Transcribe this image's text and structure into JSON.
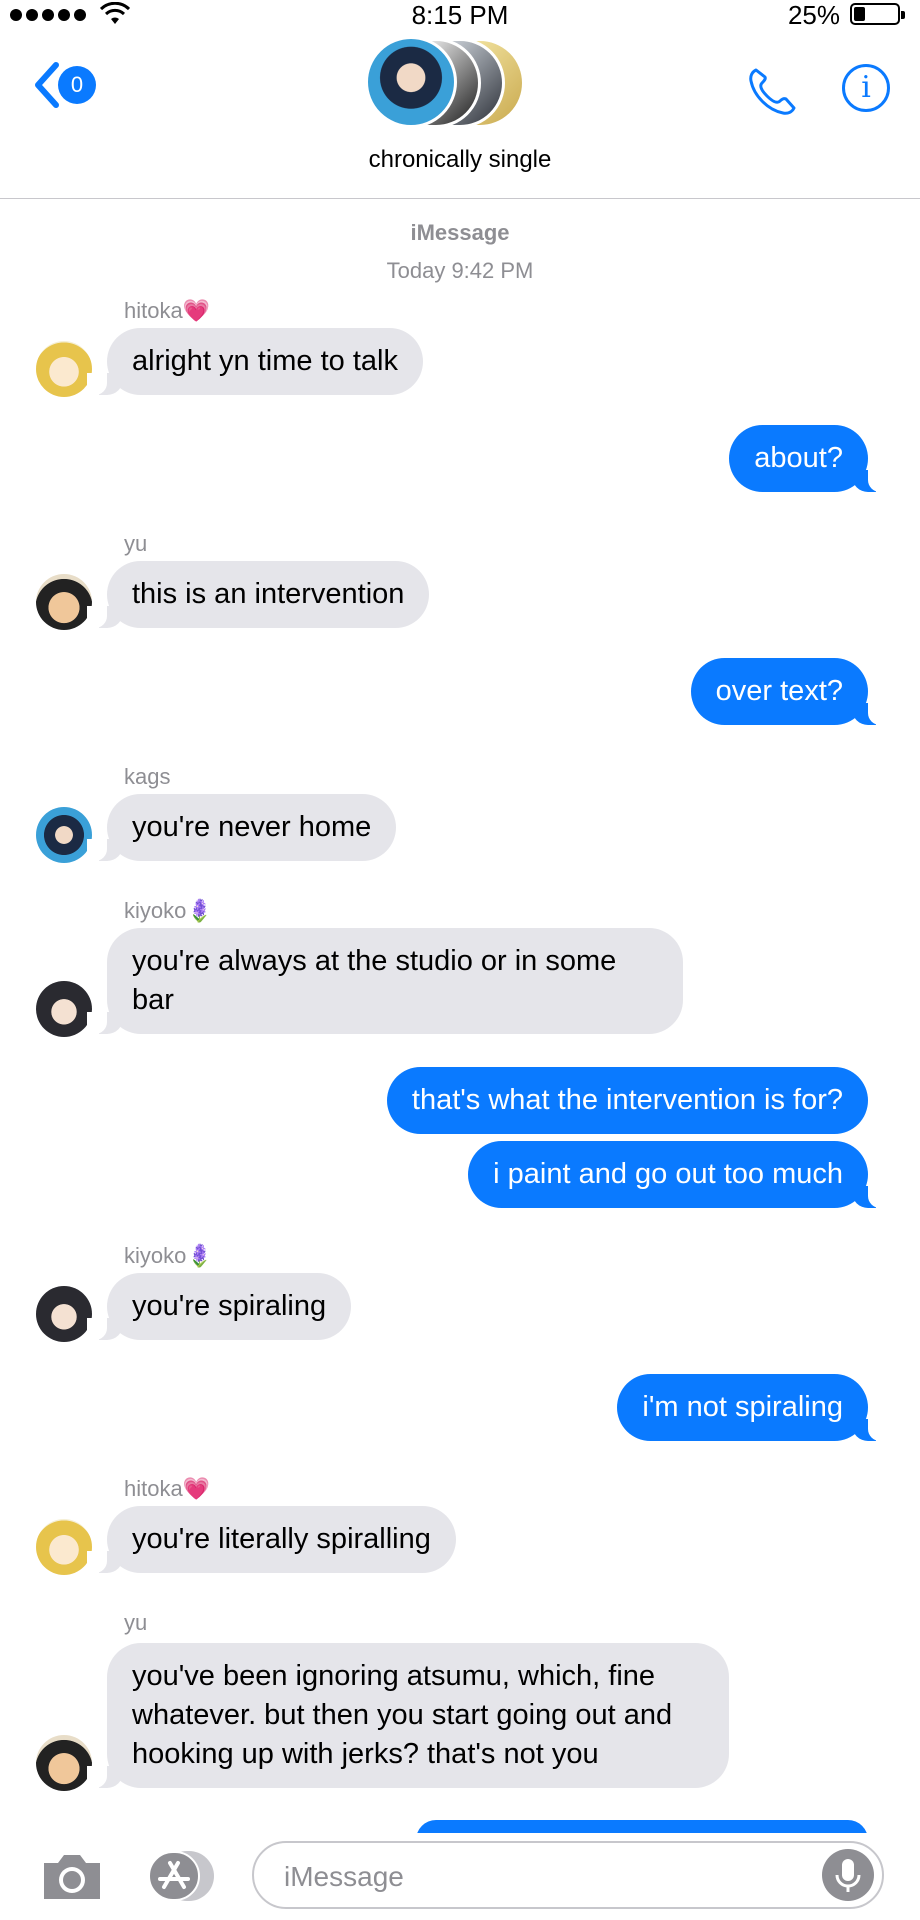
{
  "status_bar": {
    "time": "8:15 PM",
    "battery_percent": "25%",
    "battery_level": 0.25
  },
  "header": {
    "back_badge": "0",
    "group_name": "chronically single"
  },
  "conversation": {
    "service": "iMessage",
    "timestamp": "Today 9:42 PM",
    "messages": [
      {
        "sender": "hitoka",
        "sender_emoji": "💗",
        "text": "alright yn time to talk",
        "direction": "incoming"
      },
      {
        "text": "about?",
        "direction": "outgoing"
      },
      {
        "sender": "yu",
        "text": "this is an intervention",
        "direction": "incoming"
      },
      {
        "text": "over text?",
        "direction": "outgoing"
      },
      {
        "sender": "kags",
        "text": "you're never home",
        "direction": "incoming"
      },
      {
        "sender": "kiyoko",
        "sender_emoji": "🪻",
        "text": "you're always at the studio or in some bar",
        "direction": "incoming"
      },
      {
        "text": "that's what the intervention is for?",
        "direction": "outgoing"
      },
      {
        "text": "i paint and go out too much",
        "direction": "outgoing"
      },
      {
        "sender": "kiyoko",
        "sender_emoji": "🪻",
        "text": "you're spiraling",
        "direction": "incoming"
      },
      {
        "text": "i'm not spiraling",
        "direction": "outgoing"
      },
      {
        "sender": "hitoka",
        "sender_emoji": "💗",
        "text": "you're literally spiralling",
        "direction": "incoming"
      },
      {
        "sender": "yu",
        "text": "you've been ignoring atsumu, which, fine whatever. but then you start going out and hooking up with jerks? that's not you",
        "direction": "incoming"
      }
    ]
  },
  "input_bar": {
    "placeholder": "iMessage"
  },
  "icons": {
    "back": "chevron-left-icon",
    "call": "phone-icon",
    "info": "info-icon",
    "camera": "camera-icon",
    "apps": "app-store-icon",
    "mic": "microphone-icon"
  },
  "colors": {
    "accent": "#0a7aff",
    "incoming_bubble": "#e5e5ea",
    "meta_text": "#8e8e93"
  }
}
